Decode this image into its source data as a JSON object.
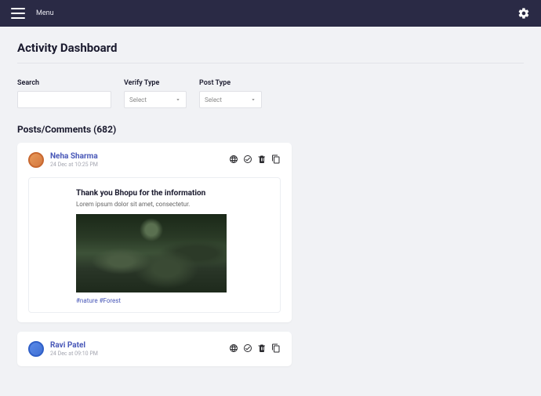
{
  "topbar": {
    "menu_label": "Menu"
  },
  "page": {
    "title": "Activity Dashboard"
  },
  "filters": {
    "search_label": "Search",
    "verify_label": "Verify Type",
    "verify_placeholder": "Select",
    "post_label": "Post Type",
    "post_placeholder": "Select"
  },
  "section": {
    "title": "Posts/Comments (682)"
  },
  "posts": [
    {
      "user": "Neha Sharma",
      "time": "24 Dec at 10:25 PM",
      "title": "Thank you Bhopu for the information",
      "body": "Lorem ipsum dolor sit amet, consectetur.",
      "tags": "#nature #Forest"
    },
    {
      "user": "Ravi Patel",
      "time": "24 Dec at 09:10 PM"
    }
  ]
}
